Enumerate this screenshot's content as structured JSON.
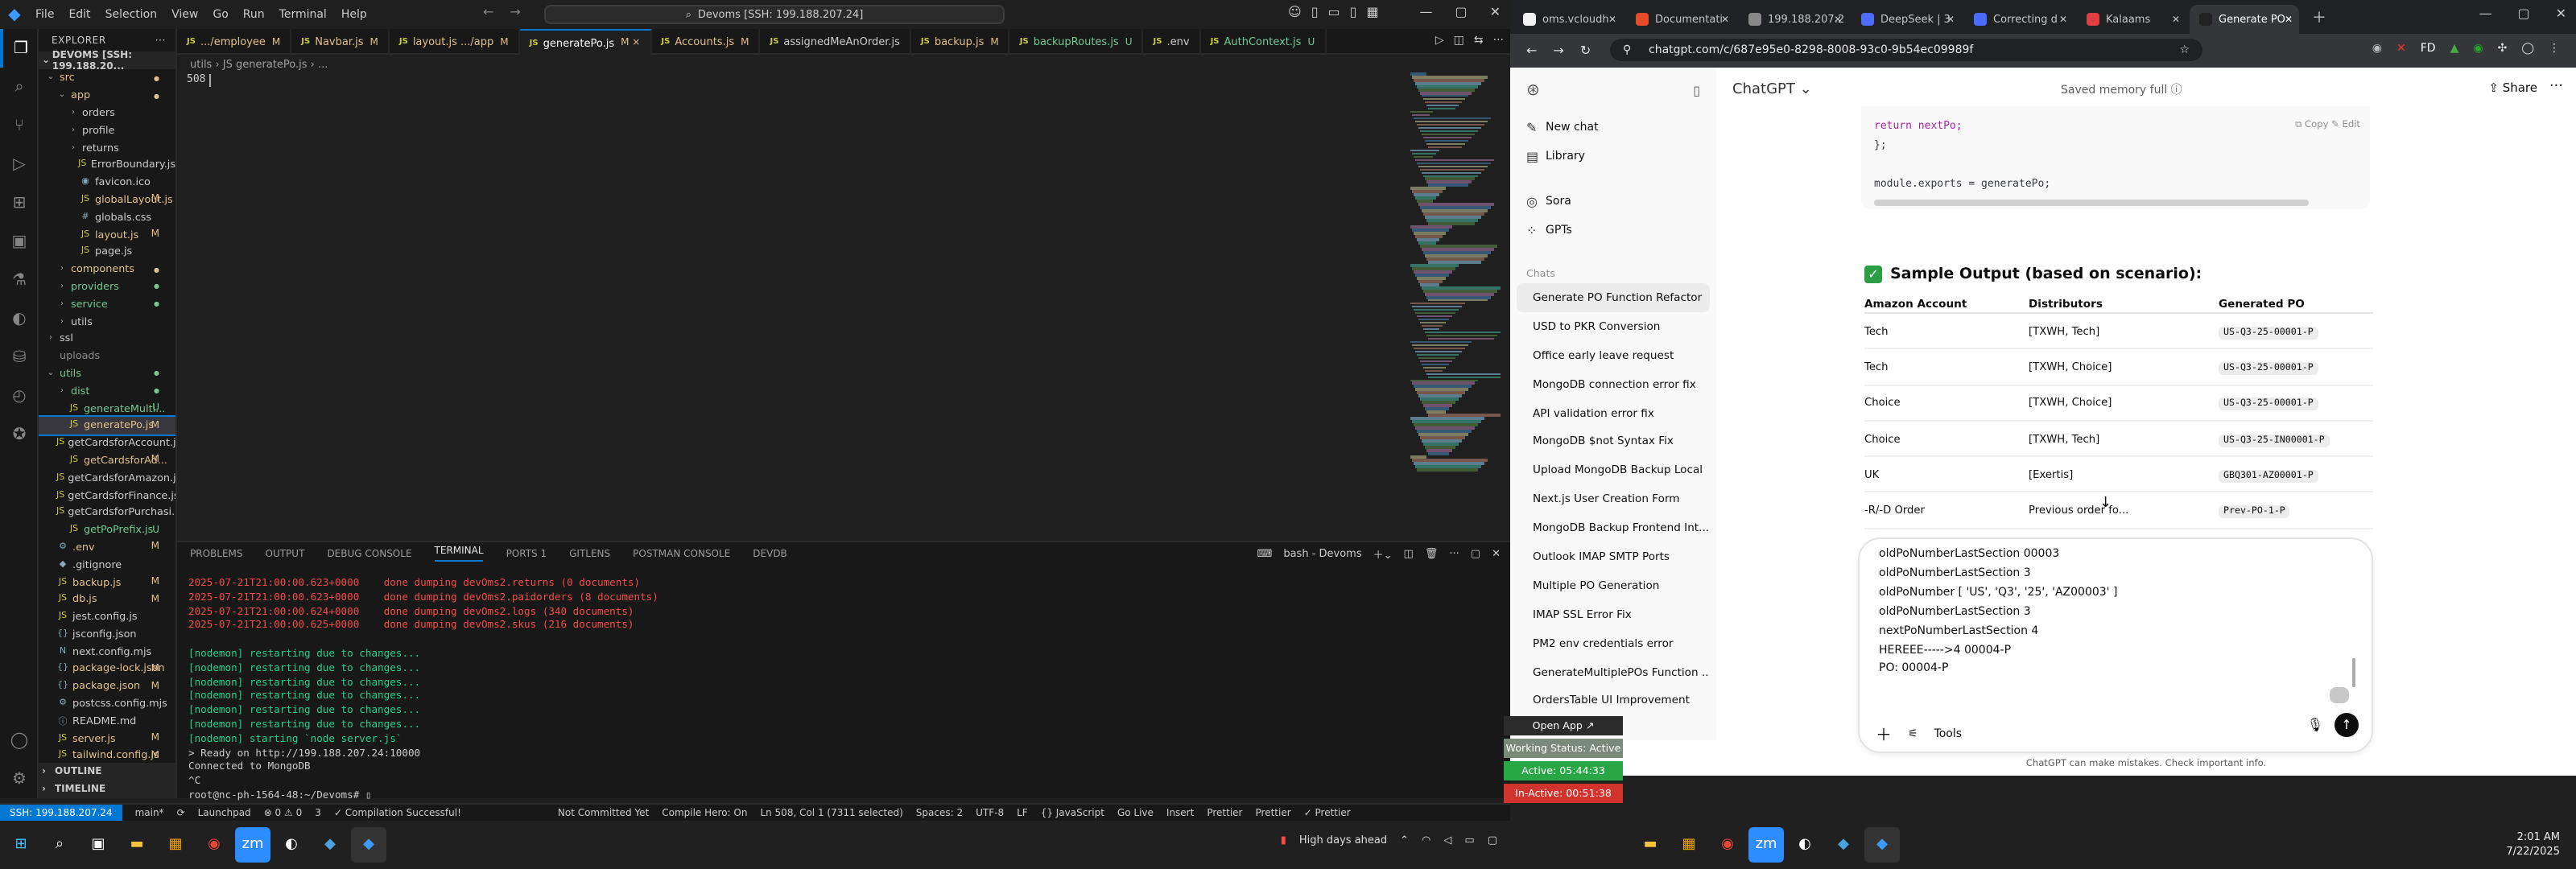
{
  "vscode": {
    "menu": [
      "File",
      "Edit",
      "Selection",
      "View",
      "Go",
      "Run",
      "Terminal",
      "Help"
    ],
    "search": "Devoms [SSH: 199.188.207.24]",
    "explorer_header": "EXPLORER",
    "explorer_root": "DEVOMS [SSH: 199.188.20...",
    "tree": [
      {
        "label": "src",
        "indent": 0,
        "chev": "⌄",
        "color": "#e2c08d",
        "status": "",
        "sc": "#e2c08d",
        "icon": ""
      },
      {
        "label": "app",
        "indent": 1,
        "chev": "⌄",
        "color": "#e2c08d",
        "status": "",
        "sc": "#e2c08d",
        "icon": ""
      },
      {
        "label": "orders",
        "indent": 2,
        "chev": "›",
        "color": "#ccc",
        "status": "",
        "sc": "",
        "icon": ""
      },
      {
        "label": "profile",
        "indent": 2,
        "chev": "›",
        "color": "#ccc",
        "status": "",
        "sc": "",
        "icon": ""
      },
      {
        "label": "returns",
        "indent": 2,
        "chev": "›",
        "color": "#ccc",
        "status": "",
        "sc": "",
        "icon": ""
      },
      {
        "label": "ErrorBoundary.js",
        "indent": 2,
        "chev": "",
        "color": "#ccc",
        "status": "",
        "sc": "",
        "icon": "JS"
      },
      {
        "label": "favicon.ico",
        "indent": 2,
        "chev": "",
        "color": "#ccc",
        "status": "",
        "sc": "",
        "icon": "◉"
      },
      {
        "label": "globalLayout.js",
        "indent": 2,
        "chev": "",
        "color": "#e2c08d",
        "status": "M",
        "sc": "#e2c08d",
        "icon": "JS"
      },
      {
        "label": "globals.css",
        "indent": 2,
        "chev": "",
        "color": "#ccc",
        "status": "",
        "sc": "",
        "icon": "#"
      },
      {
        "label": "layout.js",
        "indent": 2,
        "chev": "",
        "color": "#e2c08d",
        "status": "M",
        "sc": "#e2c08d",
        "icon": "JS"
      },
      {
        "label": "page.js",
        "indent": 2,
        "chev": "",
        "color": "#ccc",
        "status": "",
        "sc": "",
        "icon": "JS"
      },
      {
        "label": "components",
        "indent": 1,
        "chev": "›",
        "color": "#e2c08d",
        "status": "",
        "sc": "#e2c08d",
        "icon": ""
      },
      {
        "label": "providers",
        "indent": 1,
        "chev": "›",
        "color": "#73c991",
        "status": "",
        "sc": "#73c991",
        "icon": ""
      },
      {
        "label": "service",
        "indent": 1,
        "chev": "›",
        "color": "#73c991",
        "status": "",
        "sc": "#73c991",
        "icon": ""
      },
      {
        "label": "utils",
        "indent": 1,
        "chev": "›",
        "color": "#ccc",
        "status": "",
        "sc": "",
        "icon": ""
      },
      {
        "label": "ssl",
        "indent": 0,
        "chev": "›",
        "color": "#ccc",
        "status": "",
        "sc": "",
        "icon": ""
      },
      {
        "label": "uploads",
        "indent": 0,
        "chev": "",
        "color": "#8c8c8c",
        "status": "",
        "sc": "",
        "icon": ""
      },
      {
        "label": "utils",
        "indent": 0,
        "chev": "⌄",
        "color": "#73c991",
        "status": "",
        "sc": "#73c991",
        "icon": ""
      },
      {
        "label": "dist",
        "indent": 1,
        "chev": "›",
        "color": "#73c991",
        "status": "",
        "sc": "#73c991",
        "icon": ""
      },
      {
        "label": "generateMulti...",
        "indent": 1,
        "chev": "",
        "color": "#73c991",
        "status": "U",
        "sc": "#73c991",
        "icon": "JS"
      },
      {
        "label": "generatePo.js",
        "indent": 1,
        "chev": "",
        "color": "#e2c08d",
        "status": "M",
        "sc": "#e2c08d",
        "icon": "JS",
        "sel": true
      },
      {
        "label": "getCardsforAccount.js",
        "indent": 1,
        "chev": "",
        "color": "#ccc",
        "status": "",
        "sc": "",
        "icon": "JS"
      },
      {
        "label": "getCardsforAd...",
        "indent": 1,
        "chev": "",
        "color": "#e2c08d",
        "status": "M",
        "sc": "#e2c08d",
        "icon": "JS"
      },
      {
        "label": "getCardsforAmazon.js",
        "indent": 1,
        "chev": "",
        "color": "#ccc",
        "status": "",
        "sc": "",
        "icon": "JS"
      },
      {
        "label": "getCardsforFinance.js",
        "indent": 1,
        "chev": "",
        "color": "#ccc",
        "status": "",
        "sc": "",
        "icon": "JS"
      },
      {
        "label": "getCardsforPurchasi...",
        "indent": 1,
        "chev": "",
        "color": "#ccc",
        "status": "",
        "sc": "",
        "icon": "JS"
      },
      {
        "label": "getPoPrefix.js",
        "indent": 1,
        "chev": "",
        "color": "#73c991",
        "status": "U",
        "sc": "#73c991",
        "icon": "JS"
      },
      {
        "label": ".env",
        "indent": 0,
        "chev": "",
        "color": "#e2c08d",
        "status": "M",
        "sc": "#e2c08d",
        "icon": "⚙"
      },
      {
        "label": ".gitignore",
        "indent": 0,
        "chev": "",
        "color": "#ccc",
        "status": "",
        "sc": "",
        "icon": "◆"
      },
      {
        "label": "backup.js",
        "indent": 0,
        "chev": "",
        "color": "#e2c08d",
        "status": "M",
        "sc": "#e2c08d",
        "icon": "JS"
      },
      {
        "label": "db.js",
        "indent": 0,
        "chev": "",
        "color": "#e2c08d",
        "status": "M",
        "sc": "#e2c08d",
        "icon": "JS"
      },
      {
        "label": "jest.config.js",
        "indent": 0,
        "chev": "",
        "color": "#ccc",
        "status": "",
        "sc": "",
        "icon": "JS"
      },
      {
        "label": "jsconfig.json",
        "indent": 0,
        "chev": "",
        "color": "#ccc",
        "status": "",
        "sc": "",
        "icon": "{}"
      },
      {
        "label": "next.config.mjs",
        "indent": 0,
        "chev": "",
        "color": "#ccc",
        "status": "",
        "sc": "",
        "icon": "N"
      },
      {
        "label": "package-lock.json",
        "indent": 0,
        "chev": "",
        "color": "#e2c08d",
        "status": "M",
        "sc": "#e2c08d",
        "icon": "{}"
      },
      {
        "label": "package.json",
        "indent": 0,
        "chev": "",
        "color": "#e2c08d",
        "status": "M",
        "sc": "#e2c08d",
        "icon": "{}"
      },
      {
        "label": "postcss.config.mjs",
        "indent": 0,
        "chev": "",
        "color": "#ccc",
        "status": "",
        "sc": "",
        "icon": "⚙"
      },
      {
        "label": "README.md",
        "indent": 0,
        "chev": "",
        "color": "#ccc",
        "status": "",
        "sc": "",
        "icon": "ⓘ"
      },
      {
        "label": "server.js",
        "indent": 0,
        "chev": "",
        "color": "#e2c08d",
        "status": "M",
        "sc": "#e2c08d",
        "icon": "JS"
      },
      {
        "label": "tailwind.config.js",
        "indent": 0,
        "chev": "",
        "color": "#e2c08d",
        "status": "M",
        "sc": "#e2c08d",
        "icon": "JS"
      }
    ],
    "outline": "OUTLINE",
    "timeline": "TIMELINE",
    "tabs": [
      {
        "label": ".../employee",
        "m": "M",
        "mc": "#e2c08d"
      },
      {
        "label": "Navbar.js",
        "m": "M",
        "mc": "#e2c08d"
      },
      {
        "label": "layout.js .../app",
        "m": "M",
        "mc": "#e2c08d"
      },
      {
        "label": "generatePo.js",
        "m": "M ×",
        "mc": "#e2c08d",
        "active": true
      },
      {
        "label": "Accounts.js",
        "m": "M",
        "mc": "#e2c08d"
      },
      {
        "label": "assignedMeAnOrder.js",
        "m": "",
        "mc": "#ccc"
      },
      {
        "label": "backup.js",
        "m": "M",
        "mc": "#e2c08d"
      },
      {
        "label": "backupRoutes.js",
        "m": "U",
        "mc": "#73c991"
      },
      {
        "label": ".env",
        "m": "",
        "mc": "#ccc"
      },
      {
        "label": "AuthContext.js",
        "m": "U",
        "mc": "#73c991"
      }
    ],
    "breadcrumb": "utils  ›  JS generatePo.js  ›  ...",
    "line_number": "508",
    "panel_tabs": [
      "PROBLEMS",
      "OUTPUT",
      "DEBUG CONSOLE",
      "TERMINAL",
      "PORTS 1",
      "GITLENS",
      "POSTMAN CONSOLE",
      "DEVDB"
    ],
    "shell": "bash - Devoms",
    "terminal": [
      {
        "t": "2025-07-21T21:00:00.623+0000    done dumping devOms2.returns (0 documents)",
        "c": "#f14c4c"
      },
      {
        "t": "2025-07-21T21:00:00.623+0000    done dumping devOms2.paidorders (8 documents)",
        "c": "#f14c4c"
      },
      {
        "t": "2025-07-21T21:00:00.624+0000    done dumping devOms2.logs (340 documents)",
        "c": "#f14c4c"
      },
      {
        "t": "2025-07-21T21:00:00.625+0000    done dumping devOms2.skus (216 documents)",
        "c": "#f14c4c"
      },
      {
        "t": "",
        "c": "#ccc"
      },
      {
        "t": "[nodemon] restarting due to changes...",
        "c": "#23d18b"
      },
      {
        "t": "[nodemon] restarting due to changes...",
        "c": "#23d18b"
      },
      {
        "t": "[nodemon] restarting due to changes...",
        "c": "#23d18b"
      },
      {
        "t": "[nodemon] restarting due to changes...",
        "c": "#23d18b"
      },
      {
        "t": "[nodemon] restarting due to changes...",
        "c": "#23d18b"
      },
      {
        "t": "[nodemon] restarting due to changes...",
        "c": "#23d18b"
      },
      {
        "t": "[nodemon] starting `node server.js`",
        "c": "#23d18b"
      },
      {
        "t": "> Ready on http://199.188.207.24:10000",
        "c": "#cccccc"
      },
      {
        "t": "Connected to MongoDB",
        "c": "#cccccc"
      },
      {
        "t": "^C",
        "c": "#cccccc"
      },
      {
        "t": "root@nc-ph-1564-48:~/Devoms# ▯",
        "c": "#cccccc"
      }
    ],
    "status": {
      "remote": "SSH: 199.188.207.24",
      "branch": "main*",
      "sync": "⟳",
      "launchpad": "Launchpad",
      "problems": "⊗ 0 ⚠ 0",
      "ports": "3",
      "compile": "✓ Compilation Successful!",
      "commit": "Not Committed Yet",
      "hero": "Compile Hero: On",
      "position": "Ln 508, Col 1 (7311 selected)",
      "spaces": "Spaces: 2",
      "encoding": "UTF-8",
      "eol": "LF",
      "lang": "{} JavaScript",
      "golive": "Go Live",
      "insert": "Insert",
      "prettier1": "Prettier",
      "prettier2": "Prettier",
      "prettier3": "✓ Prettier"
    },
    "taskbar_weather": "High days ahead"
  },
  "chrome": {
    "tabs": [
      {
        "label": "oms.vcloudh",
        "fav": "#f2f2f2"
      },
      {
        "label": "Documentati",
        "fav": "#e44d26"
      },
      {
        "label": "199.188.207.2",
        "fav": "#888"
      },
      {
        "label": "DeepSeek | 3",
        "fav": "#4d6bfe"
      },
      {
        "label": "Correcting d",
        "fav": "#4d6bfe"
      },
      {
        "label": "Kalaams",
        "fav": "#e04040"
      },
      {
        "label": "Generate PO",
        "fav": "#222",
        "active": true
      }
    ],
    "url": "chatgpt.com/c/687e95e0-8298-8008-93c0-9b54ec09989f"
  },
  "chatgpt": {
    "nav": [
      {
        "icon": "✎",
        "label": "New chat"
      },
      {
        "icon": "▤",
        "label": "Library"
      },
      {
        "icon": "◎",
        "label": "Sora"
      },
      {
        "icon": "⁘",
        "label": "GPTs"
      }
    ],
    "chats_label": "Chats",
    "chats": [
      "Generate PO Function Refactor",
      "USD to PKR Conversion",
      "Office early leave request",
      "MongoDB connection error fix",
      "API validation error fix",
      "MongoDB $not Syntax Fix",
      "Upload MongoDB Backup Local",
      "Next.js User Creation Form",
      "MongoDB Backup Frontend Int...",
      "Outlook IMAP SMTP Ports",
      "Multiple PO Generation",
      "IMAP SSL Error Fix",
      "PM2 env credentials error",
      "GenerateMultiplePOs Function ...",
      "OrdersTable UI Improvement"
    ],
    "model": "ChatGPT ⌄",
    "memory": "Saved memory full  ⓘ",
    "share": "⇪ Share",
    "code_lines": [
      "    return nextPo;",
      "};",
      "",
      "module.exports = generatePo;"
    ],
    "code_actions": "⧉ Copy   ✎ Edit",
    "output_heading": "Sample Output (based on scenario):",
    "table": {
      "headers": [
        "Amazon Account",
        "Distributors",
        "Generated PO"
      ],
      "rows": [
        [
          "Tech",
          "[TXWH, Tech]",
          "US-Q3-25-00001-P"
        ],
        [
          "Tech",
          "[TXWH, Choice]",
          "US-Q3-25-00001-P"
        ],
        [
          "Choice",
          "[TXWH, Choice]",
          "US-Q3-25-00001-P"
        ],
        [
          "Choice",
          "[TXWH, Tech]",
          "US-Q3-25-IN00001-P"
        ],
        [
          "UK",
          "[Exertis]",
          "GBQ301-AZ00001-P"
        ],
        [
          "-R/-D Order",
          "Previous order fo...",
          "Prev-PO-1-P"
        ]
      ]
    },
    "compose_text": "oldPoNumberLastSection 00003\noldPoNumberLastSection 3\noldPoNumber [ 'US', 'Q3', '25', 'AZ00003' ]\noldPoNumberLastSection 3\nnextPoNumberLastSection 4\nHEREEE----->4 00004-P\nPO: 00004-P",
    "tools": "Tools",
    "disclaimer": "ChatGPT can make mistakes. Check important info.",
    "clock_time": "2:01 AM",
    "clock_date": "7/22/2025"
  },
  "widgets": {
    "open_app": "Open App ↗",
    "working": "Working Status: Active",
    "active": "Active: 05:44:33",
    "inactive": "In-Active: 00:51:38"
  }
}
